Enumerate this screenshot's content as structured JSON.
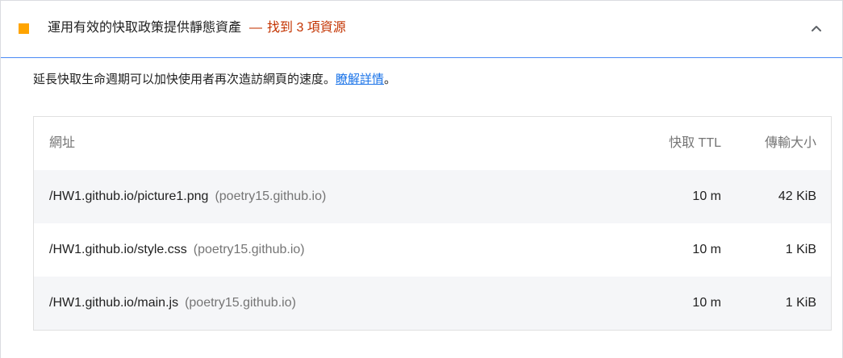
{
  "audit": {
    "title": "運用有效的快取政策提供靜態資產",
    "separator": "—",
    "found_text": "找到 3 項資源",
    "description": "延長快取生命週期可以加快使用者再次造訪網頁的速度。",
    "learn_more": "瞭解詳情",
    "description_end": "。",
    "status_color": "#ffa400",
    "expanded_icon": "chevron-up-icon"
  },
  "table": {
    "headers": {
      "url": "網址",
      "ttl": "快取 TTL",
      "size": "傳輸大小"
    },
    "rows": [
      {
        "url": "/HW1.github.io/picture1.png",
        "origin": "(poetry15.github.io)",
        "ttl": "10 m",
        "size": "42 KiB"
      },
      {
        "url": "/HW1.github.io/style.css",
        "origin": "(poetry15.github.io)",
        "ttl": "10 m",
        "size": "1 KiB"
      },
      {
        "url": "/HW1.github.io/main.js",
        "origin": "(poetry15.github.io)",
        "ttl": "10 m",
        "size": "1 KiB"
      }
    ]
  }
}
